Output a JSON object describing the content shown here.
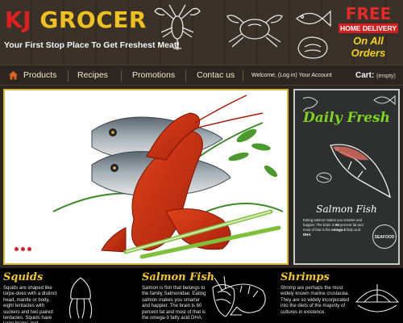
{
  "header": {
    "logo_part1": "KJ",
    "logo_part2": "GROCER",
    "tagline": "Your First Stop Place To Get Freshest Meat!",
    "promo_title": "FREE",
    "promo_sub": "HOME DELIVERY",
    "promo_tail": "On All Orders",
    "colors": {
      "red": "#e02020",
      "yellow": "#f0c020"
    }
  },
  "nav": {
    "items": [
      {
        "label": "Products",
        "icon": "home-icon"
      },
      {
        "label": "Recipes"
      },
      {
        "label": "Promotions"
      },
      {
        "label": "Contac us"
      }
    ],
    "account": {
      "welcome": "Welcome, (",
      "login": "Log in",
      "close": ")",
      "your_account": "Your Account"
    },
    "cart": {
      "label": "Cart:",
      "status": "(empty)"
    }
  },
  "hero": {
    "slide_count": 3
  },
  "sidebar": {
    "title": "Daily Fresh",
    "fish_title": "Salmon Fish",
    "text_1": "Eating salmon makes you smarter and happier. The brain is ",
    "bold_1": "60",
    "text_2": " percent fat and most of that is the ",
    "bold_2": "omega-3",
    "text_3": " fatty acid ",
    "bold_3": "DHA",
    "text_4": ".",
    "badge": "SEAFOOD"
  },
  "bottom": {
    "columns": [
      {
        "title": "Squids",
        "text": "Squids are shaped like torpe-does with a distinct head, mantle or body, eight tentacles with suckers and two paired tentacles. Squids have large brains and considered"
      },
      {
        "title": "Salmon Fish",
        "text": "Salmon is fish that belongs to the family Salmonidae. Eating salmon makes you smarter and happier. The brain is 60 percent fat and most of that is the omega-3 fatty acid DHA."
      },
      {
        "title": "Shrimps",
        "text": "Shrimp are perhaps the most widely known marine crustacea. They are so widely incorporated into the diets of the majority of cultures in existence."
      }
    ]
  }
}
